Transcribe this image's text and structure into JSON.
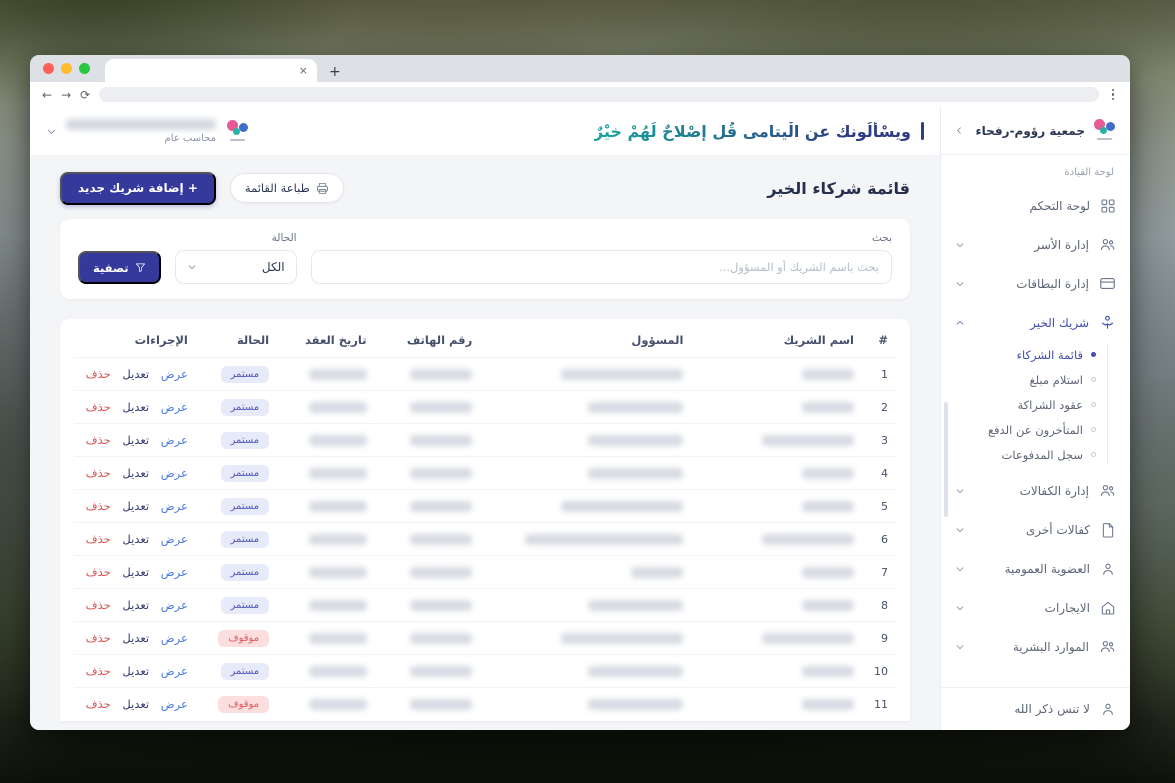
{
  "theme": {
    "primary": "#34399b",
    "accent_teal": "#1ba09a",
    "status_continuing_text": "#4f57ba",
    "status_continuing_bg": "#e7eaf9",
    "status_stopped_text": "#df5a5a",
    "status_stopped_bg": "#fbdedd"
  },
  "browser": {
    "new_tab": "+",
    "close_tab": "×",
    "back": "←",
    "forward": "→",
    "reload": "⟳"
  },
  "header": {
    "verse": "ويسْألُونك عن الْيتامى قُل إصْلاحٌ لَهُمْ خيْرٌ",
    "user_role": "محاسب عام"
  },
  "sidebar": {
    "org_name": "جمعية رؤوم-رفحاء",
    "section_label": "لوحة القيادة",
    "dashboard_label": "لوحة التحكم",
    "items": [
      {
        "label": "إدارة الأسر"
      },
      {
        "label": "إدارة البطاقات"
      },
      {
        "label": "شريك الخير"
      },
      {
        "label": "إدارة الكفالات"
      },
      {
        "label": "كفالات أخرى"
      },
      {
        "label": "العضوية العمومية"
      },
      {
        "label": "الايجارات"
      },
      {
        "label": "الموارد البشرية"
      }
    ],
    "submenu": [
      {
        "label": "قائمة الشركاء"
      },
      {
        "label": "استلام مبلغ"
      },
      {
        "label": "عقود الشراكة"
      },
      {
        "label": "المتأخرون عن الدفع"
      },
      {
        "label": "سجل المدفوعات"
      }
    ],
    "footer_label": "لا تنس ذكر الله"
  },
  "page": {
    "title": "قائمة شركاء الخير",
    "print_label": "طباعة القائمة",
    "add_label": "+ إضافة شريك جديد"
  },
  "filters": {
    "search_label": "بحث",
    "search_placeholder": "بحث باسم الشريك أو المسؤول...",
    "status_label": "الحالة",
    "status_value": "الكل",
    "filter_label": "تصفية"
  },
  "table": {
    "columns": [
      "#",
      "اسم الشريك",
      "المسؤول",
      "رقم الهاتف",
      "تاريخ العقد",
      "الحالة",
      "الإجراءات"
    ],
    "actions": [
      "عرض",
      "تعديل",
      "حذف"
    ],
    "status_labels": {
      "continuing": "مستمر",
      "stopped": "موقوف"
    },
    "rows": [
      {
        "num": "1",
        "status": "مستمر",
        "state": "ok"
      },
      {
        "num": "2",
        "status": "مستمر",
        "state": "ok"
      },
      {
        "num": "3",
        "status": "مستمر",
        "state": "ok"
      },
      {
        "num": "4",
        "status": "مستمر",
        "state": "ok"
      },
      {
        "num": "5",
        "status": "مستمر",
        "state": "ok"
      },
      {
        "num": "6",
        "status": "مستمر",
        "state": "ok"
      },
      {
        "num": "7",
        "status": "مستمر",
        "state": "ok"
      },
      {
        "num": "8",
        "status": "مستمر",
        "state": "ok"
      },
      {
        "num": "9",
        "status": "موقوف",
        "state": "stopped"
      },
      {
        "num": "10",
        "status": "مستمر",
        "state": "ok"
      },
      {
        "num": "11",
        "status": "موقوف",
        "state": "stopped"
      }
    ]
  }
}
